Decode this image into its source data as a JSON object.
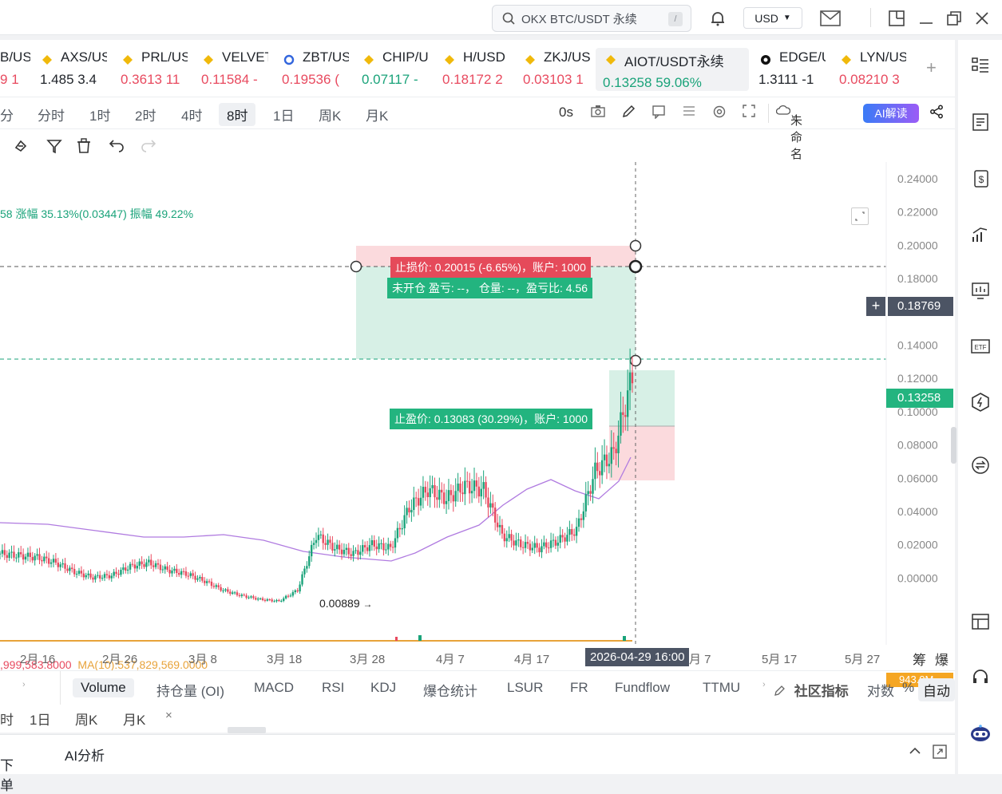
{
  "topbar": {
    "search_text": "OKX BTC/USDT 永续",
    "search_shortcut": "/",
    "currency": "USD"
  },
  "tabs": [
    {
      "symbol": "B/US",
      "price": "9",
      "change": "1",
      "color": "red"
    },
    {
      "symbol": "AXS/US",
      "price": "1.485",
      "change": "3.4",
      "color": "dark"
    },
    {
      "symbol": "PRL/US",
      "price": "0.3613",
      "change": "11",
      "color": "red"
    },
    {
      "symbol": "VELVET",
      "price": "0.11584",
      "change": "-",
      "color": "red"
    },
    {
      "symbol": "ZBT/US",
      "price": "0.19536",
      "change": "(",
      "color": "red"
    },
    {
      "symbol": "CHIP/U",
      "price": "0.07117",
      "change": "-",
      "color": "green"
    },
    {
      "symbol": "H/USD",
      "price": "0.18172",
      "change": "2",
      "color": "red"
    },
    {
      "symbol": "ZKJ/US",
      "price": "0.03103",
      "change": "1",
      "color": "red"
    },
    {
      "symbol": "AIOT/USDT永续",
      "price": "0.13258",
      "change": "59.06%",
      "color": "green"
    },
    {
      "symbol": "EDGE/U",
      "price": "1.3111",
      "change": "-1",
      "color": "dark"
    },
    {
      "symbol": "LYN/US",
      "price": "0.08210",
      "change": "3",
      "color": "red"
    }
  ],
  "periods": {
    "items": [
      "分",
      "分时",
      "1时",
      "2时",
      "4时",
      "8时",
      "1日",
      "周K",
      "月K"
    ],
    "selected": "8时",
    "countdown": "0s",
    "layout_name": "未命名",
    "ai_label": "AI解读"
  },
  "chart": {
    "info_line": "58 涨幅 35.13%(0.03447) 振幅 49.22%",
    "stop_loss": "止损价: 0.20015 (-6.65%)，账户: 1000",
    "position": "未开仓  盈亏: --，  仓量: --，盈亏比: 4.56",
    "take_profit": "止盈价: 0.13083 (30.29%)，账户: 1000",
    "crosshair_price": "0.18769",
    "last_price": "0.13258",
    "low_label": "0.00889",
    "volume_info": ",999,583.8000",
    "ma_info": "MA(10):537,829,569.0000",
    "volume_tag": "943.0M",
    "crosshair_time": "2026-04-29 16:00",
    "y_ticks": [
      "0.24000",
      "0.22000",
      "0.20000",
      "0.18000",
      "0.16000",
      "0.14000",
      "0.12000",
      "0.10000",
      "0.08000",
      "0.06000",
      "0.04000",
      "0.02000",
      "0.00000"
    ],
    "x_ticks": [
      "2月 16",
      "2月 26",
      "3月 8",
      "3月 18",
      "3月 28",
      "4月 7",
      "4月 17",
      "月 7",
      "5月 17",
      "5月 27"
    ],
    "right_labels": [
      "筹",
      "爆"
    ]
  },
  "chart_data": {
    "type": "candlestick",
    "series_ma": "MA",
    "ylim": [
      0,
      0.25
    ],
    "approx_close": [
      0.035,
      0.034,
      0.033,
      0.03,
      0.025,
      0.022,
      0.023,
      0.028,
      0.03,
      0.026,
      0.024,
      0.02,
      0.015,
      0.012,
      0.01,
      0.009,
      0.015,
      0.045,
      0.038,
      0.035,
      0.04,
      0.038,
      0.06,
      0.07,
      0.065,
      0.072,
      0.07,
      0.045,
      0.04,
      0.038,
      0.042,
      0.048,
      0.08,
      0.09,
      0.13258
    ]
  },
  "indicators": {
    "items": [
      "Volume",
      "持仓量 (OI)",
      "MACD",
      "RSI",
      "KDJ",
      "爆仓统计",
      "LSUR",
      "FR",
      "Fundflow",
      "TTMU"
    ],
    "selected": "Volume",
    "community": "社区指标",
    "log": "对数",
    "percent": "%",
    "auto": "自动"
  },
  "sub_periods": [
    "1日",
    "周K",
    "月K"
  ],
  "bottom": {
    "order": "下单",
    "ai": "AI分析"
  }
}
